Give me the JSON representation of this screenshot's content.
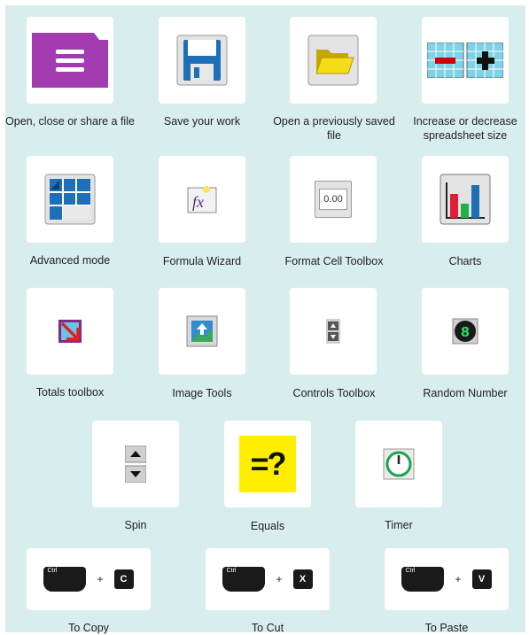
{
  "items": [
    {
      "label": "Open, close or share a file",
      "icon": "file-menu-icon"
    },
    {
      "label": "Save your work",
      "icon": "floppy-disk-icon"
    },
    {
      "label": "Open a previously saved file",
      "icon": "folder-icon"
    },
    {
      "label": "Increase or decrease spreadsheet size",
      "icon": "resize-grid-icon"
    },
    {
      "label": "Advanced mode",
      "icon": "table-grid-icon"
    },
    {
      "label": "Formula Wizard",
      "icon": "formula-fx-icon"
    },
    {
      "label": "Format Cell Toolbox",
      "icon": "number-format-icon"
    },
    {
      "label": "Charts",
      "icon": "bar-chart-icon"
    },
    {
      "label": "Totals toolbox",
      "icon": "totals-icon"
    },
    {
      "label": "Image Tools",
      "icon": "image-icon"
    },
    {
      "label": "Controls Toolbox",
      "icon": "spin-control-icon"
    },
    {
      "label": "Random Number",
      "icon": "random-number-icon"
    },
    {
      "label": "Spin",
      "icon": "spin-buttons-icon"
    },
    {
      "label": "Equals",
      "icon": "equals-question-icon"
    },
    {
      "label": "Timer",
      "icon": "timer-icon"
    }
  ],
  "format_value": "0.00",
  "random_digit": "8",
  "equals_text": "=?",
  "shortcuts": [
    {
      "label": "To Copy",
      "ctrl": "Ctrl",
      "plus": "+",
      "key": "C"
    },
    {
      "label": "To Cut",
      "ctrl": "Ctrl",
      "plus": "+",
      "key": "X"
    },
    {
      "label": "To Paste",
      "ctrl": "Ctrl",
      "plus": "+",
      "key": "V"
    }
  ],
  "colors": {
    "background": "#d8eded",
    "tile": "#ffffff",
    "file_purple": "#a23bb0",
    "equals_yellow": "#ffee00"
  }
}
